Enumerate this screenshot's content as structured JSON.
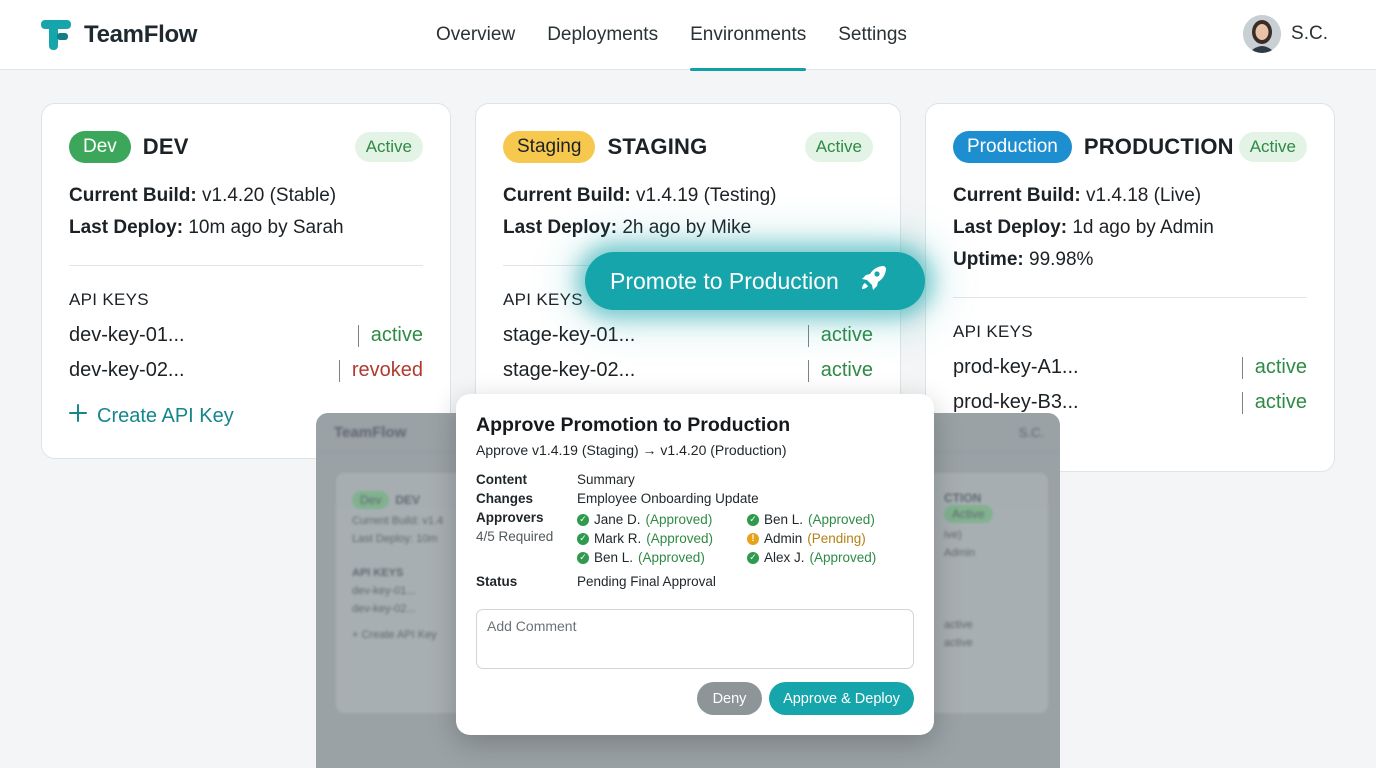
{
  "app": {
    "name": "TeamFlow",
    "user_initials": "S.C."
  },
  "nav": {
    "items": [
      {
        "label": "Overview",
        "active": false
      },
      {
        "label": "Deployments",
        "active": false
      },
      {
        "label": "Environments",
        "active": true
      },
      {
        "label": "Settings",
        "active": false
      }
    ]
  },
  "colors": {
    "accent": "#16a5ab",
    "dev": "#3ca75a",
    "staging": "#f6c94e",
    "production": "#1d8fd1",
    "active_text": "#2e8a45",
    "revoked_text": "#b03a30"
  },
  "labels": {
    "current_build": "Current Build:",
    "last_deploy": "Last Deploy:",
    "uptime": "Uptime:",
    "api_keys": "API KEYS",
    "create_api_key": "Create API Key",
    "promote_button": "Promote to Production"
  },
  "environments": [
    {
      "pill": "Dev",
      "title": "DEV",
      "status": "Active",
      "current_build": "v1.4.20 (Stable)",
      "last_deploy": "10m ago by Sarah",
      "keys": [
        {
          "name": "dev-key-01...",
          "status": "active"
        },
        {
          "name": "dev-key-02...",
          "status": "revoked"
        }
      ]
    },
    {
      "pill": "Staging",
      "title": "STAGING",
      "status": "Active",
      "current_build": "v1.4.19 (Testing)",
      "last_deploy": "2h ago by Mike",
      "keys": [
        {
          "name": "stage-key-01...",
          "status": "active"
        },
        {
          "name": "stage-key-02...",
          "status": "active"
        }
      ]
    },
    {
      "pill": "Production",
      "title": "PRODUCTION",
      "status": "Active",
      "current_build": "v1.4.18 (Live)",
      "last_deploy": "1d ago by Admin",
      "uptime": "99.98%",
      "keys": [
        {
          "name": "prod-key-A1...",
          "status": "active"
        },
        {
          "name": "prod-key-B3...",
          "status": "active"
        }
      ]
    }
  ],
  "backdrop": {
    "logo": "TeamFlow",
    "user": "S.C.",
    "pill": "Dev",
    "title": "DEV",
    "line1": "Current Build: v1.4",
    "line2": "Last Deploy: 10m",
    "keys_title": "API KEYS",
    "key1": "dev-key-01...",
    "key2": "dev-key-02...",
    "create": "+ Create API Key",
    "right_title": "CTION",
    "right_status": "Active",
    "right_l1": "ive)",
    "right_l2": "Admin",
    "right_k1": "active",
    "right_k2": "active"
  },
  "dialog": {
    "title": "Approve Promotion to Production",
    "subtitle": "Approve v1.4.19 (Staging) → v1.4.20 (Production)",
    "content_label": "Content",
    "content_value": "Summary",
    "changes_label": "Changes",
    "changes_value": "Employee Onboarding Update",
    "approvers_label": "Approvers",
    "approvers_required": "4/5 Required",
    "approvers": [
      {
        "name": "Jane D.",
        "state": "(Approved)",
        "kind": "ok"
      },
      {
        "name": "Ben L.",
        "state": "(Approved)",
        "kind": "ok"
      },
      {
        "name": "Mark R.",
        "state": "(Approved)",
        "kind": "ok"
      },
      {
        "name": "Admin",
        "state": "(Pending)",
        "kind": "pend"
      },
      {
        "name": "Ben L.",
        "state": "(Approved)",
        "kind": "ok"
      },
      {
        "name": "Alex J.",
        "state": "(Approved)",
        "kind": "ok"
      }
    ],
    "status_label": "Status",
    "status_value": "Pending Final Approval",
    "comment_placeholder": "Add Comment",
    "deny_label": "Deny",
    "approve_label": "Approve & Deploy"
  }
}
